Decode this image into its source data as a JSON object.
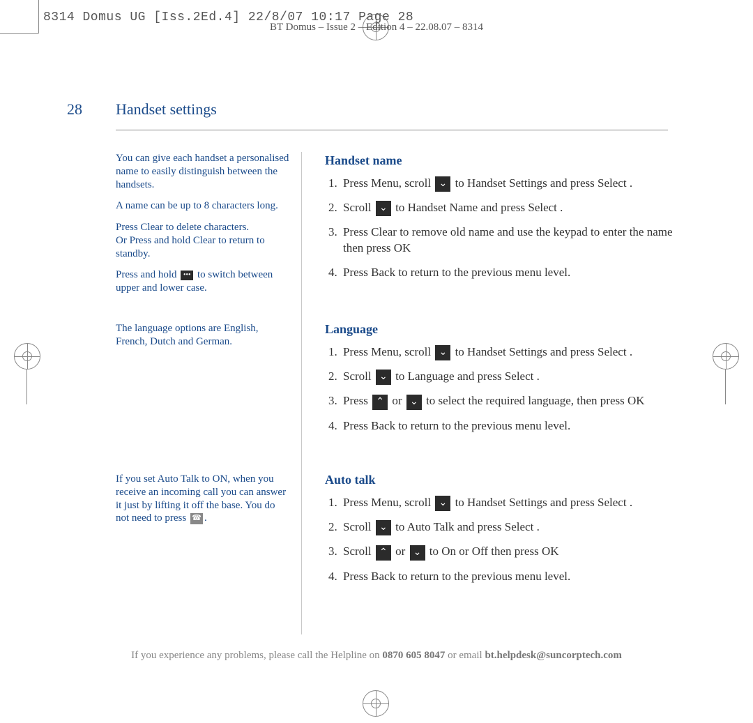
{
  "meta": {
    "mono_header": "8314 Domus UG [Iss.2Ed.4]  22/8/07  10:17  Page 28",
    "edition_line": "BT Domus – Issue 2 – Edition 4 – 22.08.07 – 8314"
  },
  "page": {
    "number": "28",
    "title": "Handset settings"
  },
  "sidebar": {
    "block1": {
      "p1": "You can give each handset a personalised name to easily distinguish between the handsets.",
      "p2": "A name can be up to 8 characters long.",
      "p3a": "Press Clear to delete characters.",
      "p3b": "Or Press and hold Clear to return to standby.",
      "p4_before": "Press and hold ",
      "p4_after": " to switch between upper and lower case."
    },
    "block2": {
      "p1": "The language options are English, French, Dutch and German."
    },
    "block3": {
      "p1_before": "If you set Auto Talk to ON, when you receive an incoming call you can answer it just by lifting it off the base. You do not need to press ",
      "p1_after": "."
    }
  },
  "sections": {
    "handset_name": {
      "title": "Handset name",
      "s1": {
        "a": "Press Menu, scroll ",
        "b": " to Handset Settings    and press Select ."
      },
      "s2": {
        "a": "Scroll ",
        "b": " to Handset Name and press Select ."
      },
      "s3": "Press Clear to remove old name and use the keypad to enter the name then press OK",
      "s4": "Press Back to return to the previous menu level."
    },
    "language": {
      "title": "Language",
      "s1": {
        "a": "Press Menu, scroll ",
        "b": " to Handset Settings    and press Select ."
      },
      "s2": {
        "a": "Scroll ",
        "b": " to Language  and press Select ."
      },
      "s3": {
        "a": "Press ",
        "b": " or ",
        "c": " to select the required language, then press OK"
      },
      "s4": "Press Back to return to the previous menu level."
    },
    "auto_talk": {
      "title": "Auto talk",
      "s1": {
        "a": "Press Menu, scroll ",
        "b": " to Handset  Settings    and press Select ."
      },
      "s2": {
        "a": "Scroll ",
        "b": " to Auto  Talk  and press Select ."
      },
      "s3": {
        "a": "Scroll ",
        "b": " or ",
        "c": " to On or Off  then press OK"
      },
      "s4": "Press Back to return to the previous menu level."
    }
  },
  "helpline": {
    "pre": "If you experience any problems, please call the Helpline on ",
    "phone": "0870 605 8047",
    "mid": " or email ",
    "email": "bt.helpdesk@suncorptech.com"
  }
}
